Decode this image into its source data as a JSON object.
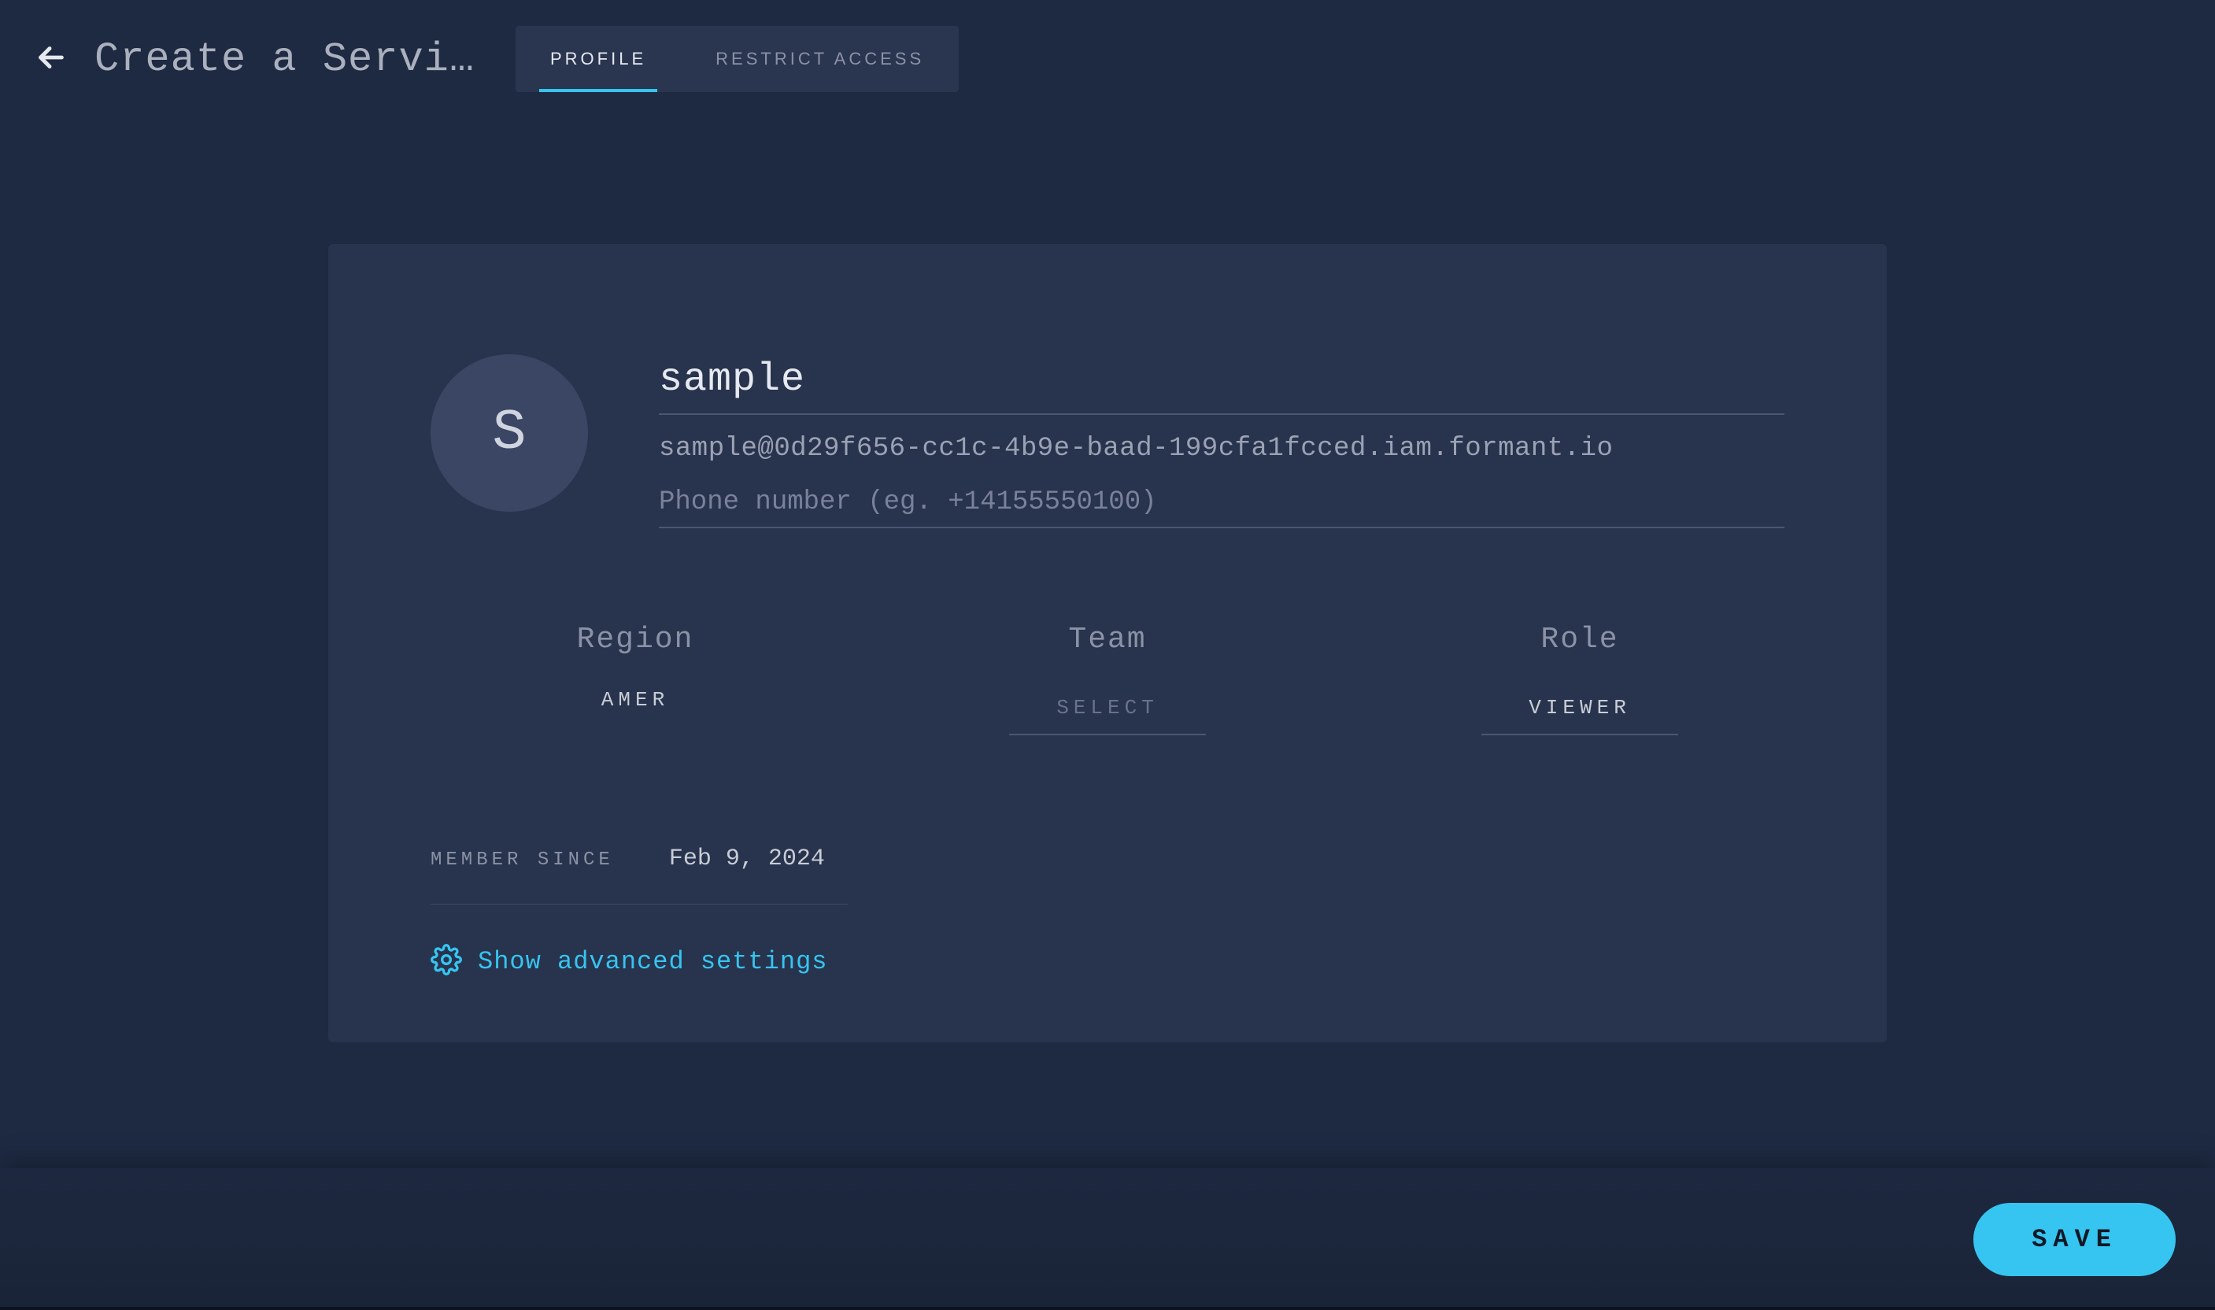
{
  "header": {
    "title": "Create a Service…",
    "tabs": [
      {
        "label": "PROFILE",
        "active": true
      },
      {
        "label": "RESTRICT ACCESS",
        "active": false
      }
    ]
  },
  "profile": {
    "avatar_initial": "S",
    "name": "sample",
    "email": "sample@0d29f656-cc1c-4b9e-baad-199cfa1fcced.iam.formant.io",
    "phone_value": "",
    "phone_placeholder": "Phone number (eg. +14155550100)"
  },
  "details": {
    "region": {
      "label": "Region",
      "value": "AMER"
    },
    "team": {
      "label": "Team",
      "value": "SELECT"
    },
    "role": {
      "label": "Role",
      "value": "VIEWER"
    }
  },
  "member": {
    "label": "MEMBER SINCE",
    "value": "Feb 9, 2024"
  },
  "advanced": {
    "label": "Show advanced settings"
  },
  "footer": {
    "save_label": "SAVE"
  },
  "colors": {
    "accent": "#36c5f0",
    "card_bg": "#28334d",
    "page_bg": "#1e2a42"
  }
}
